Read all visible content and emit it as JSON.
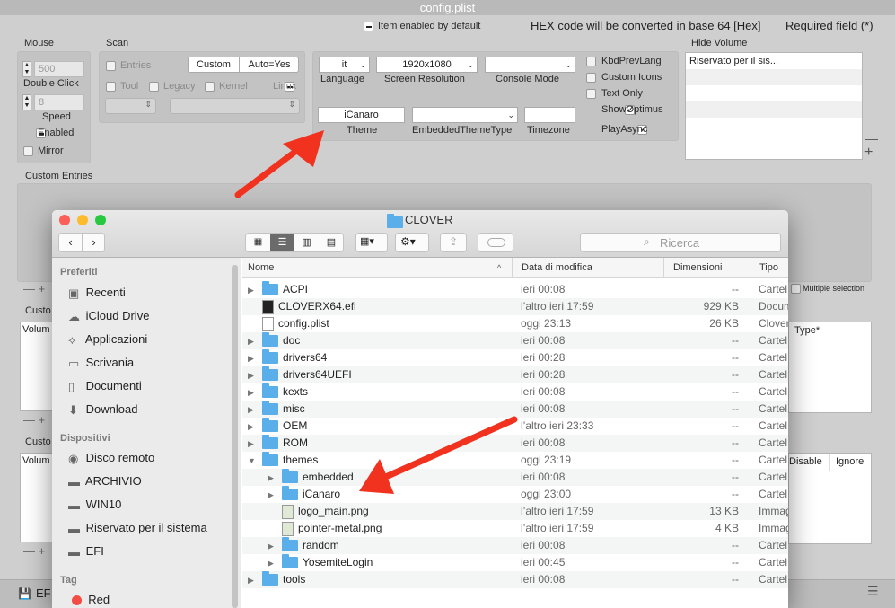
{
  "config_window": {
    "title": "config.plist",
    "header": {
      "item_enabled": "Item enabled by default",
      "hex_note": "HEX code will be converted in base 64 [Hex]",
      "required": "Required field (*)"
    },
    "mouse": {
      "label": "Mouse",
      "double_click_value": "500",
      "double_click_label": "Double Click",
      "speed_value": "8",
      "speed_label": "Speed",
      "enabled": "Enabled",
      "mirror": "Mirror"
    },
    "scan": {
      "label": "Scan",
      "entries": "Entries",
      "custom": "Custom",
      "auto": "Auto=Yes",
      "tool": "Tool",
      "legacy": "Legacy",
      "kernel": "Kernel",
      "linux": "Linux"
    },
    "gui": {
      "language_value": "it",
      "language_label": "Language",
      "resolution_value": "1920x1080",
      "resolution_label": "Screen Resolution",
      "console_value": "",
      "console_label": "Console Mode",
      "theme_value": "iCanaro",
      "theme_label": "Theme",
      "embedded_theme_label": "EmbeddedThemeType",
      "timezone_label": "Timezone",
      "kbd": "KbdPrevLang",
      "custom_icons": "Custom Icons",
      "text_only": "Text Only",
      "show_optimus": "ShowOptimus",
      "play_async": "PlayAsync"
    },
    "hide_volume": {
      "label": "Hide Volume",
      "item": "Riservato per il sis..."
    },
    "custom_entries": "Custom Entries",
    "custom_short_1": "Custo",
    "custom_short_2": "Custo",
    "volume_short_1": "Volum",
    "volume_short_2": "Volum",
    "multiple_selection": "Multiple selection",
    "type_col": "Type*",
    "disable_col": "Disable",
    "ignore_col": "Ignore",
    "bottom_left": "EF"
  },
  "finder": {
    "title": "CLOVER",
    "search_placeholder": "Ricerca",
    "sidebar": {
      "favorites_head": "Preferiti",
      "favorites": [
        "Recenti",
        "iCloud Drive",
        "Applicazioni",
        "Scrivania",
        "Documenti",
        "Download"
      ],
      "devices_head": "Dispositivi",
      "devices": [
        "Disco remoto",
        "ARCHIVIO",
        "WIN10",
        "Riservato per il sistema",
        "EFI"
      ],
      "tags_head": "Tag",
      "tags": [
        "Red"
      ]
    },
    "columns": {
      "name": "Nome",
      "date": "Data di modifica",
      "size": "Dimensioni",
      "kind": "Tipo"
    },
    "rows": [
      {
        "name": "ACPI",
        "date": "ieri 00:08",
        "size": "--",
        "kind": "Cartel",
        "type": "folder",
        "indent": 0,
        "tri": "▶"
      },
      {
        "name": "CLOVERX64.efi",
        "date": "l’altro ieri 17:59",
        "size": "929 KB",
        "kind": "Docum",
        "type": "exec",
        "indent": 0,
        "tri": ""
      },
      {
        "name": "config.plist",
        "date": "oggi 23:13",
        "size": "26 KB",
        "kind": "Clover",
        "type": "file",
        "indent": 0,
        "tri": ""
      },
      {
        "name": "doc",
        "date": "ieri 00:08",
        "size": "--",
        "kind": "Cartel",
        "type": "folder",
        "indent": 0,
        "tri": "▶"
      },
      {
        "name": "drivers64",
        "date": "ieri 00:28",
        "size": "--",
        "kind": "Cartel",
        "type": "folder",
        "indent": 0,
        "tri": "▶"
      },
      {
        "name": "drivers64UEFI",
        "date": "ieri 00:28",
        "size": "--",
        "kind": "Cartel",
        "type": "folder",
        "indent": 0,
        "tri": "▶"
      },
      {
        "name": "kexts",
        "date": "ieri 00:08",
        "size": "--",
        "kind": "Cartel",
        "type": "folder",
        "indent": 0,
        "tri": "▶"
      },
      {
        "name": "misc",
        "date": "ieri 00:08",
        "size": "--",
        "kind": "Cartel",
        "type": "folder",
        "indent": 0,
        "tri": "▶"
      },
      {
        "name": "OEM",
        "date": "l’altro ieri 23:33",
        "size": "--",
        "kind": "Cartel",
        "type": "folder",
        "indent": 0,
        "tri": "▶"
      },
      {
        "name": "ROM",
        "date": "ieri 00:08",
        "size": "--",
        "kind": "Cartel",
        "type": "folder",
        "indent": 0,
        "tri": "▶"
      },
      {
        "name": "themes",
        "date": "oggi 23:19",
        "size": "--",
        "kind": "Cartel",
        "type": "folder",
        "indent": 0,
        "tri": "▼"
      },
      {
        "name": "embedded",
        "date": "ieri 00:08",
        "size": "--",
        "kind": "Cartel",
        "type": "folder",
        "indent": 1,
        "tri": "▶"
      },
      {
        "name": "iCanaro",
        "date": "oggi 23:00",
        "size": "--",
        "kind": "Cartel",
        "type": "folder",
        "indent": 1,
        "tri": "▶"
      },
      {
        "name": "logo_main.png",
        "date": "l’altro ieri 17:59",
        "size": "13 KB",
        "kind": "Immag",
        "type": "image",
        "indent": 1,
        "tri": ""
      },
      {
        "name": "pointer-metal.png",
        "date": "l’altro ieri 17:59",
        "size": "4 KB",
        "kind": "Immag",
        "type": "image",
        "indent": 1,
        "tri": ""
      },
      {
        "name": "random",
        "date": "ieri 00:08",
        "size": "--",
        "kind": "Cartel",
        "type": "folder",
        "indent": 1,
        "tri": "▶"
      },
      {
        "name": "YosemiteLogin",
        "date": "ieri 00:45",
        "size": "--",
        "kind": "Cartel",
        "type": "folder",
        "indent": 1,
        "tri": "▶"
      },
      {
        "name": "tools",
        "date": "ieri 00:08",
        "size": "--",
        "kind": "Cartel",
        "type": "folder",
        "indent": 0,
        "tri": "▶"
      }
    ]
  },
  "colors": {
    "annotation_arrow": "#f0321e",
    "folder": "#5aaee9"
  }
}
